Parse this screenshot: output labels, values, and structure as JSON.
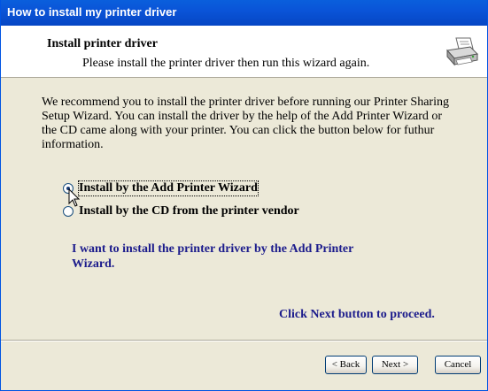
{
  "window": {
    "title": "How to install my printer driver"
  },
  "header": {
    "title": "Install printer driver",
    "subtitle": "Please install the printer driver then run this wizard again.",
    "icon": "printer-icon"
  },
  "body": {
    "intro": "We recommend you to install the printer driver before running our Printer Sharing Setup Wizard. You can install the driver by the help of the Add Printer Wizard or the CD came along with your printer. You can click the button below for futhur information."
  },
  "options": [
    {
      "label": "Install by the Add Printer Wizard",
      "selected": true
    },
    {
      "label": "Install by the CD from the printer vendor",
      "selected": false
    }
  ],
  "description": "I want to install the printer driver by the Add Printer Wizard.",
  "proceed_text": "Click Next button to proceed.",
  "buttons": {
    "back": "< Back",
    "next": "Next >",
    "cancel": "Cancel"
  },
  "colors": {
    "titlebar": "#0a54d8",
    "dialog_bg": "#ece9d8",
    "accent_text": "#1c1c8c"
  }
}
